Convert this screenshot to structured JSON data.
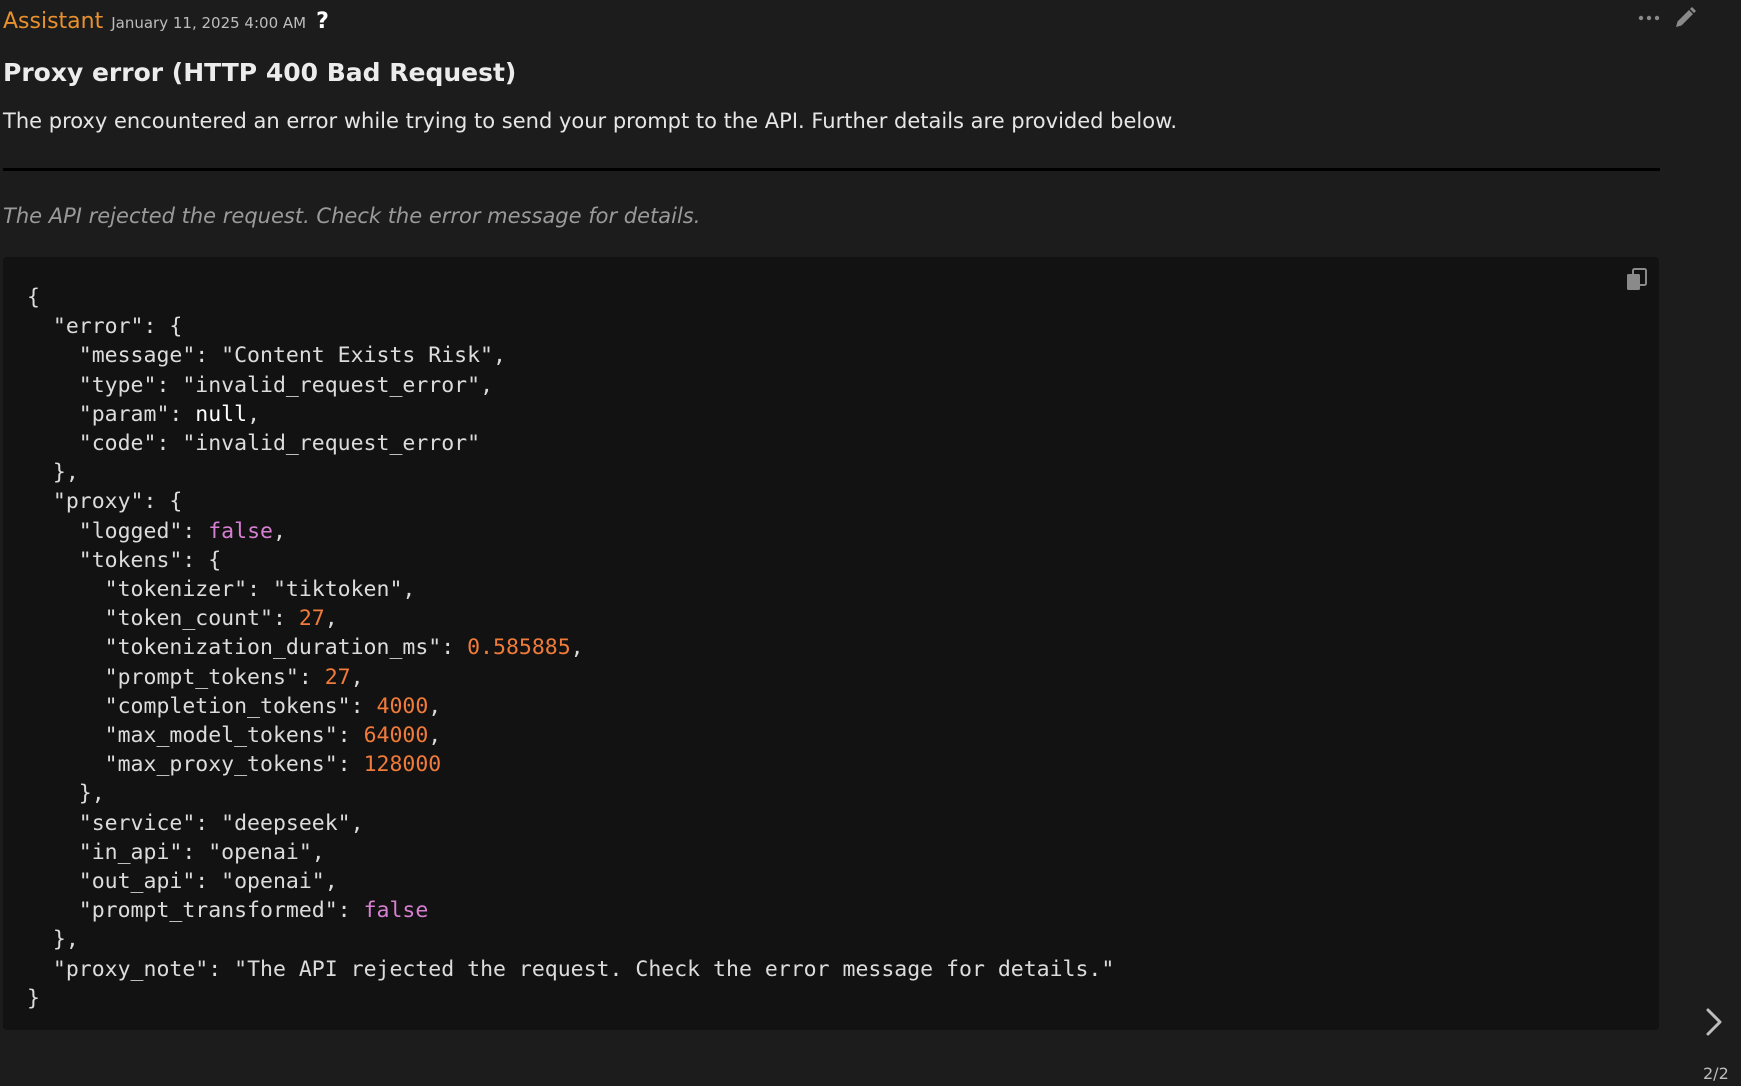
{
  "message": {
    "author": "Assistant",
    "timestamp": "January 11, 2025 4:00 AM",
    "help_glyph": "?",
    "title": "Proxy error (HTTP 400 Bad Request)",
    "description": "The proxy encountered an error while trying to send your prompt to the API. Further details are provided below.",
    "note": "The API rejected the request. Check the error message for details."
  },
  "icons": {
    "more": "more-horizontal-icon",
    "edit": "pencil-icon",
    "copy": "copy-icon",
    "next": "chevron-right-icon"
  },
  "colors": {
    "author": "#e8912d",
    "number": "#f07b3a",
    "boolean": "#d77fd1",
    "code_bg": "#121212",
    "page_bg": "#1c1c1c"
  },
  "code": {
    "lines": [
      [
        {
          "t": "p",
          "v": "{"
        }
      ],
      [
        {
          "t": "p",
          "v": "  "
        },
        {
          "t": "k",
          "v": "\"error\""
        },
        {
          "t": "p",
          "v": ": {"
        }
      ],
      [
        {
          "t": "p",
          "v": "    "
        },
        {
          "t": "k",
          "v": "\"message\""
        },
        {
          "t": "p",
          "v": ": "
        },
        {
          "t": "s",
          "v": "\"Content Exists Risk\""
        },
        {
          "t": "p",
          "v": ","
        }
      ],
      [
        {
          "t": "p",
          "v": "    "
        },
        {
          "t": "k",
          "v": "\"type\""
        },
        {
          "t": "p",
          "v": ": "
        },
        {
          "t": "s",
          "v": "\"invalid_request_error\""
        },
        {
          "t": "p",
          "v": ","
        }
      ],
      [
        {
          "t": "p",
          "v": "    "
        },
        {
          "t": "k",
          "v": "\"param\""
        },
        {
          "t": "p",
          "v": ": "
        },
        {
          "t": "n",
          "v": "null"
        },
        {
          "t": "p",
          "v": ","
        }
      ],
      [
        {
          "t": "p",
          "v": "    "
        },
        {
          "t": "k",
          "v": "\"code\""
        },
        {
          "t": "p",
          "v": ": "
        },
        {
          "t": "s",
          "v": "\"invalid_request_error\""
        }
      ],
      [
        {
          "t": "p",
          "v": "  },"
        }
      ],
      [
        {
          "t": "p",
          "v": "  "
        },
        {
          "t": "k",
          "v": "\"proxy\""
        },
        {
          "t": "p",
          "v": ": {"
        }
      ],
      [
        {
          "t": "p",
          "v": "    "
        },
        {
          "t": "k",
          "v": "\"logged\""
        },
        {
          "t": "p",
          "v": ": "
        },
        {
          "t": "b",
          "v": "false"
        },
        {
          "t": "p",
          "v": ","
        }
      ],
      [
        {
          "t": "p",
          "v": "    "
        },
        {
          "t": "k",
          "v": "\"tokens\""
        },
        {
          "t": "p",
          "v": ": {"
        }
      ],
      [
        {
          "t": "p",
          "v": "      "
        },
        {
          "t": "k",
          "v": "\"tokenizer\""
        },
        {
          "t": "p",
          "v": ": "
        },
        {
          "t": "s",
          "v": "\"tiktoken\""
        },
        {
          "t": "p",
          "v": ","
        }
      ],
      [
        {
          "t": "p",
          "v": "      "
        },
        {
          "t": "k",
          "v": "\"token_count\""
        },
        {
          "t": "p",
          "v": ": "
        },
        {
          "t": "num",
          "v": "27"
        },
        {
          "t": "p",
          "v": ","
        }
      ],
      [
        {
          "t": "p",
          "v": "      "
        },
        {
          "t": "k",
          "v": "\"tokenization_duration_ms\""
        },
        {
          "t": "p",
          "v": ": "
        },
        {
          "t": "num",
          "v": "0.585885"
        },
        {
          "t": "p",
          "v": ","
        }
      ],
      [
        {
          "t": "p",
          "v": "      "
        },
        {
          "t": "k",
          "v": "\"prompt_tokens\""
        },
        {
          "t": "p",
          "v": ": "
        },
        {
          "t": "num",
          "v": "27"
        },
        {
          "t": "p",
          "v": ","
        }
      ],
      [
        {
          "t": "p",
          "v": "      "
        },
        {
          "t": "k",
          "v": "\"completion_tokens\""
        },
        {
          "t": "p",
          "v": ": "
        },
        {
          "t": "num",
          "v": "4000"
        },
        {
          "t": "p",
          "v": ","
        }
      ],
      [
        {
          "t": "p",
          "v": "      "
        },
        {
          "t": "k",
          "v": "\"max_model_tokens\""
        },
        {
          "t": "p",
          "v": ": "
        },
        {
          "t": "num",
          "v": "64000"
        },
        {
          "t": "p",
          "v": ","
        }
      ],
      [
        {
          "t": "p",
          "v": "      "
        },
        {
          "t": "k",
          "v": "\"max_proxy_tokens\""
        },
        {
          "t": "p",
          "v": ": "
        },
        {
          "t": "num",
          "v": "128000"
        }
      ],
      [
        {
          "t": "p",
          "v": "    },"
        }
      ],
      [
        {
          "t": "p",
          "v": "    "
        },
        {
          "t": "k",
          "v": "\"service\""
        },
        {
          "t": "p",
          "v": ": "
        },
        {
          "t": "s",
          "v": "\"deepseek\""
        },
        {
          "t": "p",
          "v": ","
        }
      ],
      [
        {
          "t": "p",
          "v": "    "
        },
        {
          "t": "k",
          "v": "\"in_api\""
        },
        {
          "t": "p",
          "v": ": "
        },
        {
          "t": "s",
          "v": "\"openai\""
        },
        {
          "t": "p",
          "v": ","
        }
      ],
      [
        {
          "t": "p",
          "v": "    "
        },
        {
          "t": "k",
          "v": "\"out_api\""
        },
        {
          "t": "p",
          "v": ": "
        },
        {
          "t": "s",
          "v": "\"openai\""
        },
        {
          "t": "p",
          "v": ","
        }
      ],
      [
        {
          "t": "p",
          "v": "    "
        },
        {
          "t": "k",
          "v": "\"prompt_transformed\""
        },
        {
          "t": "p",
          "v": ": "
        },
        {
          "t": "b",
          "v": "false"
        }
      ],
      [
        {
          "t": "p",
          "v": "  },"
        }
      ],
      [
        {
          "t": "p",
          "v": "  "
        },
        {
          "t": "k",
          "v": "\"proxy_note\""
        },
        {
          "t": "p",
          "v": ": "
        },
        {
          "t": "s",
          "v": "\"The API rejected the request. Check the error message for details.\""
        }
      ],
      [
        {
          "t": "p",
          "v": "}"
        }
      ]
    ]
  },
  "pager": {
    "count": "2/2"
  }
}
